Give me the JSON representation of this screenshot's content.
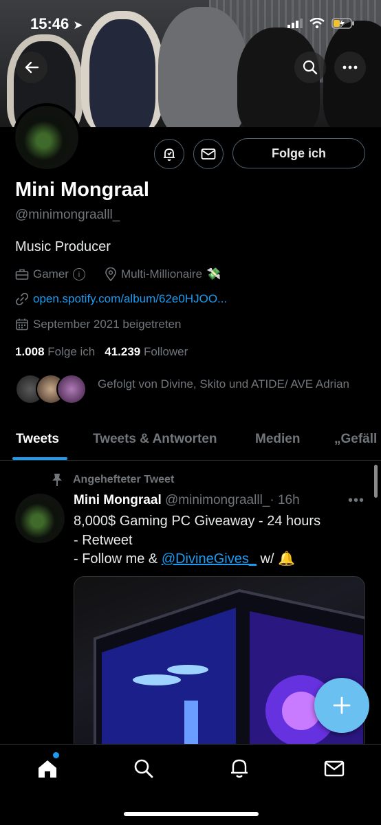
{
  "status_bar": {
    "time": "15:46"
  },
  "profile": {
    "name": "Mini Mongraal",
    "handle": "@minimongraalll_",
    "bio": "Music Producer",
    "category": "Gamer",
    "location": "Multi-Millionaire",
    "location_emoji": "💸",
    "link": "open.spotify.com/album/62e0HJOO...",
    "joined": "September 2021 beigetreten",
    "following_count": "1.008",
    "following_label": "Folge ich",
    "followers_count": "41.239",
    "followers_label": "Follower",
    "followed_by": "Gefolgt von Divine, Skito und ATIDE/ AVE Adrian",
    "follow_button": "Folge ich"
  },
  "tabs": [
    {
      "label": "Tweets",
      "active": true
    },
    {
      "label": "Tweets & Antworten",
      "active": false
    },
    {
      "label": "Medien",
      "active": false
    },
    {
      "label": "„Gefäll",
      "active": false
    }
  ],
  "tweet": {
    "pinned_label": "Angehefteter Tweet",
    "author": "Mini Mongraal",
    "handle": "@minimongraalll_",
    "time": "· 16h",
    "line1": "8,000$ Gaming PC Giveaway - 24 hours",
    "line2": "- Retweet",
    "line3_prefix": "- Follow me & ",
    "line3_link": "@DivineGives_",
    "line3_suffix": " w/ 🔔"
  },
  "colors": {
    "accent": "#1d9bf0",
    "background": "#000000",
    "muted": "#71767b",
    "fab": "#6bc0f2"
  },
  "icons": [
    "back-arrow-icon",
    "search-icon",
    "more-icon",
    "notification-bell-icon",
    "mail-icon",
    "briefcase-icon",
    "info-icon",
    "location-pin-icon",
    "link-icon",
    "calendar-icon",
    "pin-icon",
    "compose-plus-icon",
    "home-icon",
    "search-nav-icon",
    "bell-nav-icon",
    "messages-icon"
  ]
}
